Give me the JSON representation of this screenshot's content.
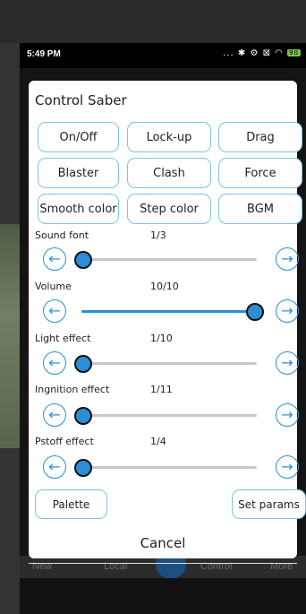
{
  "status_bar": {
    "time": "5:49 PM",
    "icons": "... ✱ ⚙ ⊠ ◠",
    "battery": "90"
  },
  "dialog": {
    "title": "Control Saber",
    "buttons": [
      [
        "On/Off",
        "Lock-up",
        "Drag"
      ],
      [
        "Blaster",
        "Clash",
        "Force"
      ],
      [
        "Smooth color",
        "Step color",
        "BGM"
      ]
    ],
    "sliders": [
      {
        "label": "Sound font",
        "value": "1/3",
        "level": 0
      },
      {
        "label": "Volume",
        "value": "10/10",
        "level": 1
      },
      {
        "label": "Light effect",
        "value": "1/10",
        "level": 0
      },
      {
        "label": "Ingnition effect",
        "value": "1/11",
        "level": 0
      },
      {
        "label": "Pstoff effect",
        "value": "1/4",
        "level": 0
      }
    ],
    "prev_icon": "arrow-left-circle-icon",
    "next_icon": "arrow-right-circle-icon",
    "palette_label": "Palette",
    "set_params_label": "Set params",
    "cancel_label": "Cancel"
  },
  "bottom_nav": {
    "items": [
      "New",
      "Local",
      "Control",
      "More"
    ]
  },
  "colors": {
    "accent": "#2a8fd6",
    "button_border": "#7cc2e6"
  }
}
